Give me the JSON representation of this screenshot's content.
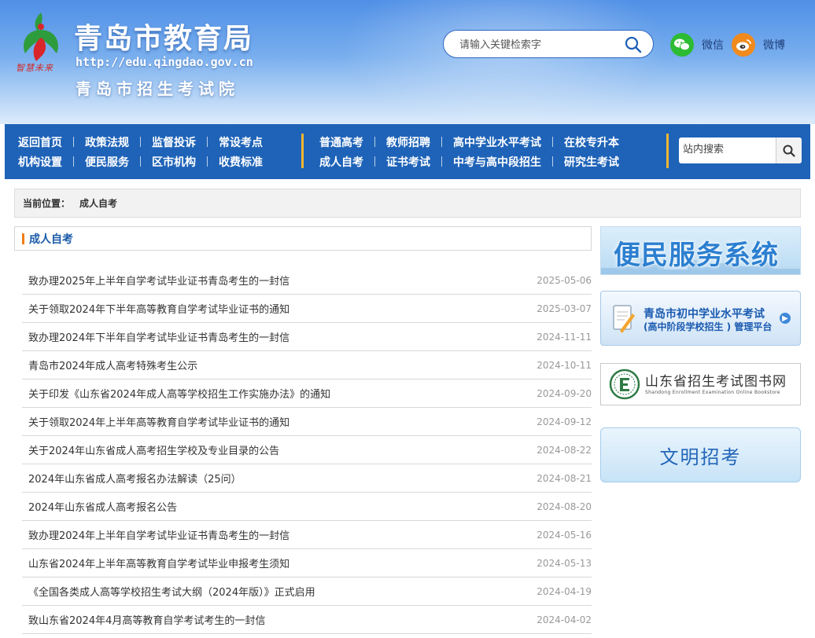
{
  "header": {
    "title": "青岛市教育局",
    "url": "http://edu.qingdao.gov.cn",
    "subtitle": "青岛市招生考试院",
    "motto": "智慧未来",
    "search_placeholder": "请输入关键检索字",
    "social": [
      {
        "label": "微信",
        "icon": "wechat-icon",
        "color": "#2dbb34"
      },
      {
        "label": "微博",
        "icon": "weibo-icon",
        "color": "#f08a1c"
      }
    ]
  },
  "nav": {
    "group1": {
      "row1": [
        "返回首页",
        "政策法规",
        "监督投诉",
        "常设考点"
      ],
      "row2": [
        "机构设置",
        "便民服务",
        "区市机构",
        "收费标准"
      ]
    },
    "group2": {
      "row1": [
        "普通高考",
        "教师招聘",
        "高中学业水平考试",
        "在校专升本"
      ],
      "row2": [
        "成人自考",
        "证书考试",
        "中考与高中段招生",
        "研究生考试"
      ]
    },
    "search_placeholder": "站内搜索"
  },
  "breadcrumb": {
    "label": "当前位置：",
    "current": "成人自考"
  },
  "section_title": "成人自考",
  "news": [
    {
      "title": "致办理2025年上半年自学考试毕业证书青岛考生的一封信",
      "date": "2025-05-06"
    },
    {
      "title": "关于领取2024年下半年高等教育自学考试毕业证书的通知",
      "date": "2025-03-07"
    },
    {
      "title": "致办理2024年下半年自学考试毕业证书青岛考生的一封信",
      "date": "2024-11-11"
    },
    {
      "title": "青岛市2024年成人高考特殊考生公示",
      "date": "2024-10-11"
    },
    {
      "title": "关于印发《山东省2024年成人高等学校招生工作实施办法》的通知",
      "date": "2024-09-20"
    },
    {
      "title": "关于领取2024年上半年高等教育自学考试毕业证书的通知",
      "date": "2024-09-12"
    },
    {
      "title": "关于2024年山东省成人高考招生学校及专业目录的公告",
      "date": "2024-08-22"
    },
    {
      "title": "2024年山东省成人高考报名办法解读（25问）",
      "date": "2024-08-21"
    },
    {
      "title": "2024年山东省成人高考报名公告",
      "date": "2024-08-20"
    },
    {
      "title": "致办理2024年上半年自学考试毕业证书青岛考生的一封信",
      "date": "2024-05-16"
    },
    {
      "title": "山东省2024年上半年高等教育自学考试毕业申报考生须知",
      "date": "2024-05-13"
    },
    {
      "title": "《全国各类成人高等学校招生考试大纲（2024年版）》正式启用",
      "date": "2024-04-19"
    },
    {
      "title": "致山东省2024年4月高等教育自学考试考生的一封信",
      "date": "2024-04-02"
    }
  ],
  "sidebar": {
    "banner1": "便民服务系统",
    "banner2": {
      "line1": "青岛市初中学业水平考试",
      "line2": "(高中阶段学校招生 ) 管理平台"
    },
    "banner3": {
      "line1": "山东省招生考试图书网",
      "line2": "Shandong Enrollment Examination Online Bookstore"
    },
    "banner4": "文明招考"
  },
  "colors": {
    "nav_bg": "#1e63b8",
    "accent_orange": "#f07d15",
    "title_blue": "#1a5aa8",
    "divider_gold": "#f2b532"
  }
}
